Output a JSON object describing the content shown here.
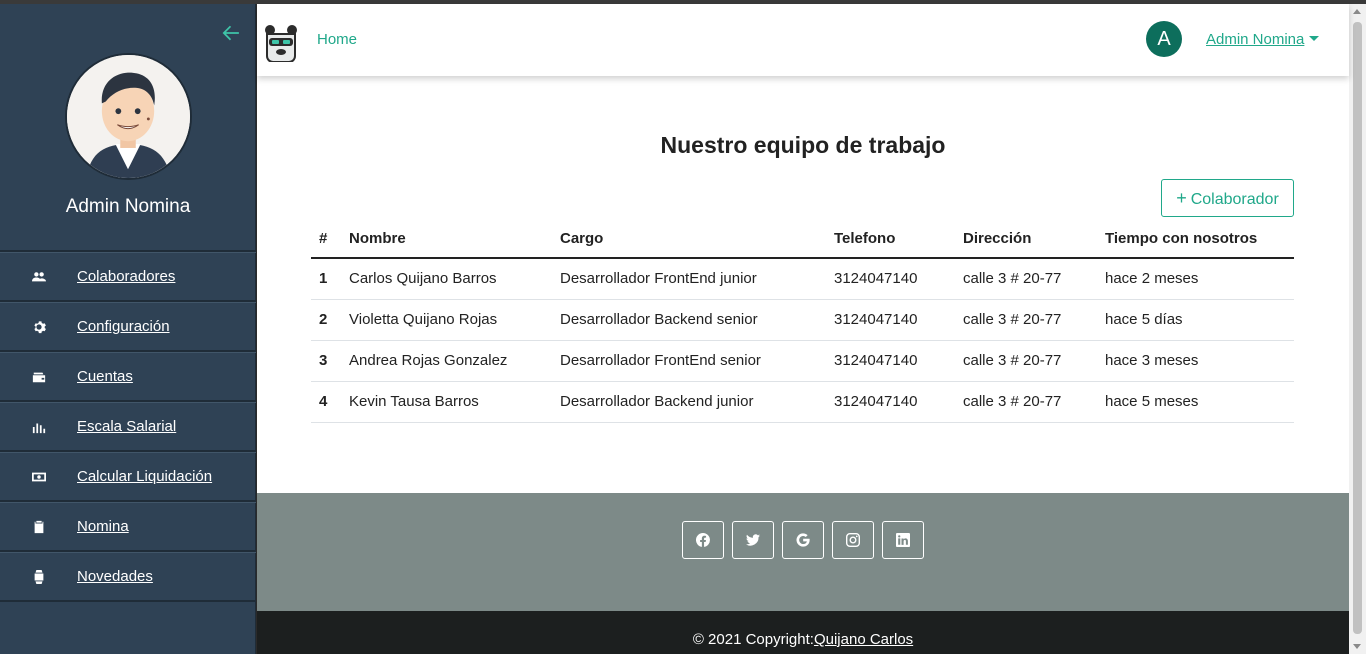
{
  "sidebar": {
    "user_name": "Admin Nomina",
    "items": [
      {
        "label": "Colaboradores",
        "icon": "users-icon"
      },
      {
        "label": "Configuración",
        "icon": "gear-icon"
      },
      {
        "label": "Cuentas",
        "icon": "wallet-icon"
      },
      {
        "label": "Escala Salarial",
        "icon": "bar-chart-icon"
      },
      {
        "label": "Calcular Liquidación",
        "icon": "money-icon"
      },
      {
        "label": "Nomina",
        "icon": "clipboard-icon"
      },
      {
        "label": "Novedades",
        "icon": "watch-icon"
      }
    ]
  },
  "navbar": {
    "home_label": "Home",
    "avatar_letter": "A",
    "user_label": "Admin Nomina"
  },
  "main": {
    "title": "Nuestro equipo de trabajo",
    "add_button_label": "Colaborador",
    "table": {
      "headers": [
        "#",
        "Nombre",
        "Cargo",
        "Telefono",
        "Dirección",
        "Tiempo con nosotros"
      ],
      "rows": [
        [
          "1",
          "Carlos Quijano Barros",
          "Desarrollador FrontEnd junior",
          "3124047140",
          "calle 3 # 20-77",
          "hace 2 meses"
        ],
        [
          "2",
          "Violetta Quijano Rojas",
          "Desarrollador Backend senior",
          "3124047140",
          "calle 3 # 20-77",
          "hace 5 días"
        ],
        [
          "3",
          "Andrea Rojas Gonzalez",
          "Desarrollador FrontEnd senior",
          "3124047140",
          "calle 3 # 20-77",
          "hace 3 meses"
        ],
        [
          "4",
          "Kevin Tausa Barros",
          "Desarrollador Backend junior",
          "3124047140",
          "calle 3 # 20-77",
          "hace 5 meses"
        ]
      ]
    }
  },
  "footer": {
    "social": [
      "facebook-icon",
      "twitter-icon",
      "google-icon",
      "instagram-icon",
      "linkedin-icon"
    ],
    "copyright_prefix": "© 2021 Copyright:",
    "copyright_link": "Quijano Carlos"
  },
  "colors": {
    "accent": "#20a88a",
    "sidebar_bg": "#2f4255",
    "footer_social_bg": "#7d8a88",
    "footer_bottom_bg": "#1c1f1f"
  }
}
